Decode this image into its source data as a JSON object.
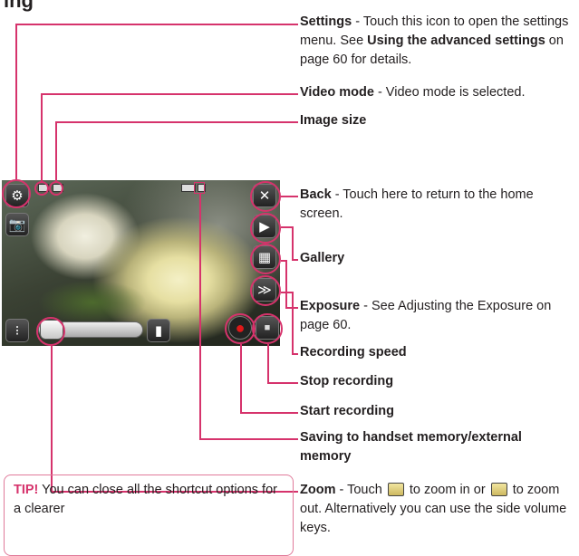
{
  "heading_fragment": "ing",
  "annotations": {
    "settings": {
      "label": "Settings",
      "text": " - Touch this icon to open the settings menu. See ",
      "link": "Using the advanced settings",
      "text2": " on page 60 for details."
    },
    "video_mode": {
      "label": "Video mode",
      "text": " - Video mode is selected."
    },
    "image_size": {
      "label": "Image size"
    },
    "back": {
      "label": "Back",
      "text": " - Touch here to return to the home screen."
    },
    "gallery": {
      "label": "Gallery"
    },
    "exposure": {
      "label": "Exposure",
      "text": " - See Adjusting the Exposure on page 60."
    },
    "recording_speed": {
      "label": "Recording speed"
    },
    "stop_recording": {
      "label": "Stop recording"
    },
    "start_recording": {
      "label": "Start recording"
    },
    "saving": {
      "label": "Saving to handset memory/external memory"
    },
    "zoom": {
      "label": "Zoom",
      "text1": " - Touch ",
      "text2": " to zoom in or ",
      "text3": " to zoom out. Alternatively you can use the side volume keys."
    }
  },
  "tip": {
    "label": "TIP!",
    "text": " You can close all the shortcut options for a clearer"
  },
  "colors": {
    "accent": "#d6336c",
    "text": "#231f20"
  },
  "icons": {
    "settings": "gear-icon",
    "video_mode": "video-camera-icon",
    "image_size": "image-size-icon",
    "back": "close-icon",
    "gallery": "gallery-icon",
    "exposure": "exposure-icon",
    "recording_speed": "recording-speed-icon",
    "stop": "stop-icon",
    "record": "record-icon",
    "zoom": "zoom-slider",
    "memory": "memory-icon"
  }
}
